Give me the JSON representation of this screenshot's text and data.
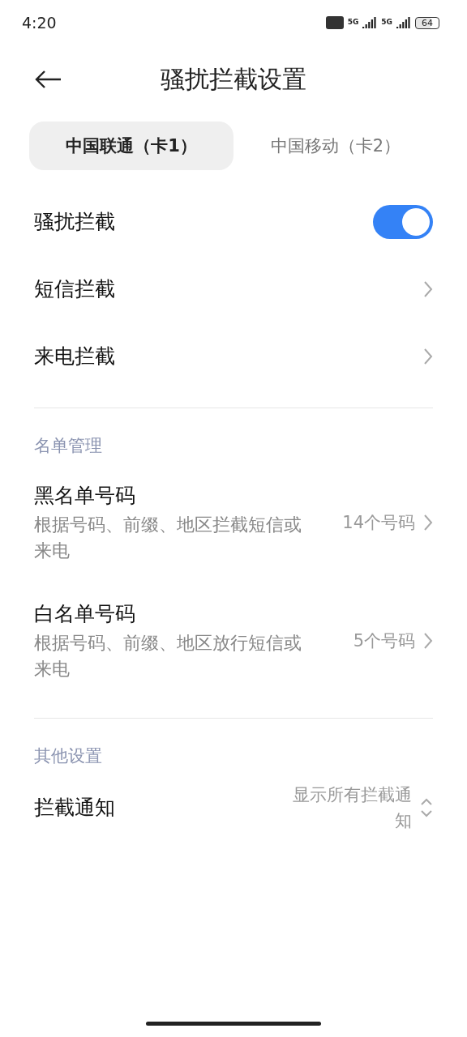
{
  "status_bar": {
    "time": "4:20",
    "networks": [
      "5G",
      "5G"
    ],
    "battery": "64"
  },
  "header": {
    "title": "骚扰拦截设置"
  },
  "tabs": [
    {
      "label": "中国联通（卡1）",
      "selected": true
    },
    {
      "label": "中国移动（卡2）",
      "selected": false
    }
  ],
  "main_rows": [
    {
      "kind": "toggle",
      "label": "骚扰拦截",
      "on": true
    },
    {
      "kind": "link",
      "label": "短信拦截"
    },
    {
      "kind": "link",
      "label": "来电拦截"
    }
  ],
  "sections": [
    {
      "title": "名单管理",
      "rows": [
        {
          "kind": "link",
          "label": "黑名单号码",
          "subtitle": "根据号码、前缀、地区拦截短信或来电",
          "value": "14个号码"
        },
        {
          "kind": "link",
          "label": "白名单号码",
          "subtitle": "根据号码、前缀、地区放行短信或来电",
          "value": "5个号码"
        }
      ]
    },
    {
      "title": "其他设置",
      "rows": [
        {
          "kind": "select",
          "label": "拦截通知",
          "value": "显示所有拦截通知"
        }
      ]
    }
  ]
}
